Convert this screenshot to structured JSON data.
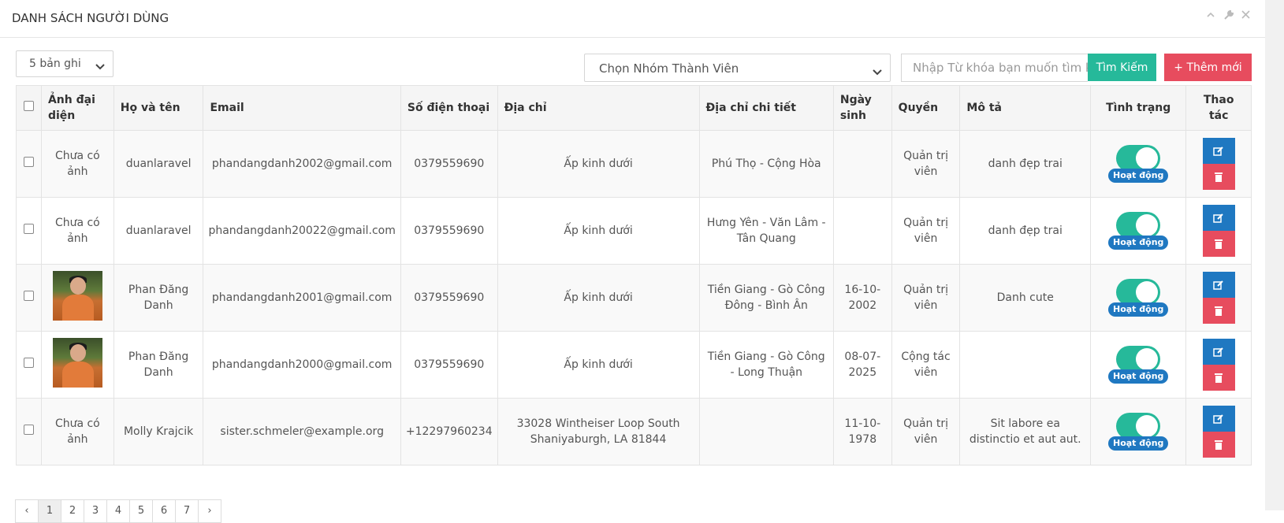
{
  "panel": {
    "title": "DANH SÁCH NGƯỜI DÙNG",
    "tools": [
      "chevron-up-icon",
      "wrench-icon",
      "close-icon"
    ]
  },
  "controls": {
    "records_per_page": "5 bản ghi",
    "group_select": "Chọn Nhóm Thành Viên",
    "search_placeholder": "Nhập Từ khóa bạn muốn tìm kiếm",
    "search_button": "Tìm Kiếm",
    "add_button": "+ Thêm mới"
  },
  "table": {
    "headers": [
      "Ảnh đại diện",
      "Họ và tên",
      "Email",
      "Số điện thoại",
      "Địa chỉ",
      "Địa chỉ chi tiết",
      "Ngày sinh",
      "Quyền",
      "Mô tả",
      "Tình trạng",
      "Thao tác"
    ],
    "rows": [
      {
        "avatar": "Chưa có ảnh",
        "name": "duanlaravel",
        "email": "phandangdanh2002@gmail.com",
        "phone": "0379559690",
        "address": "Ấp kinh dưới",
        "address_detail": "Phú Thọ - Cộng Hòa",
        "birthday": "",
        "role": "Quản trị viên",
        "description": "danh đẹp trai",
        "status": "Hoạt động"
      },
      {
        "avatar": "Chưa có ảnh",
        "name": "duanlaravel",
        "email": "phandangdanh20022@gmail.com",
        "phone": "0379559690",
        "address": "Ấp kinh dưới",
        "address_detail": "Hưng Yên - Văn Lâm - Tân Quang",
        "birthday": "",
        "role": "Quản trị viên",
        "description": "danh đẹp trai",
        "status": "Hoạt động"
      },
      {
        "avatar": "photo",
        "name": "Phan Đăng Danh",
        "email": "phandangdanh2001@gmail.com",
        "phone": "0379559690",
        "address": "Ấp kinh dưới",
        "address_detail": "Tiền Giang - Gò Công Đông - Bình Ân",
        "birthday": "16-10-2002",
        "role": "Quản trị viên",
        "description": "Danh cute",
        "status": "Hoạt động"
      },
      {
        "avatar": "photo",
        "name": "Phan Đăng Danh",
        "email": "phandangdanh2000@gmail.com",
        "phone": "0379559690",
        "address": "Ấp kinh dưới",
        "address_detail": "Tiền Giang - Gò Công - Long Thuận",
        "birthday": "08-07-2025",
        "role": "Cộng tác viên",
        "description": "",
        "status": "Hoạt động"
      },
      {
        "avatar": "Chưa có ảnh",
        "name": "Molly Krajcik",
        "email": "sister.schmeler@example.org",
        "phone": "+12297960234",
        "address": "33028 Wintheiser Loop South Shaniyaburgh, LA 81844",
        "address_detail": "",
        "birthday": "11-10-1978",
        "role": "Quản trị viên",
        "description": "Sit labore ea distinctio et aut aut.",
        "status": "Hoạt động"
      }
    ]
  },
  "pagination": {
    "prev": "‹",
    "pages": [
      "1",
      "2",
      "3",
      "4",
      "5",
      "6",
      "7"
    ],
    "next": "›",
    "active": "1"
  },
  "colors": {
    "success": "#26b99a",
    "danger": "#e74c5e",
    "primary": "#1f78c1"
  }
}
